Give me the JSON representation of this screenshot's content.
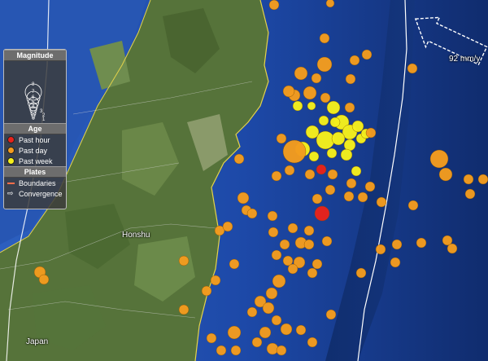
{
  "legend": {
    "magnitude_title": "Magnitude",
    "magnitude_scale": [
      "8",
      "7",
      "6",
      "5",
      "4",
      "3",
      "2",
      "1"
    ],
    "age_title": "Age",
    "age_items": [
      {
        "label": "Past hour",
        "color": "#e8231b"
      },
      {
        "label": "Past day",
        "color": "#f39c1f"
      },
      {
        "label": "Past week",
        "color": "#f5f01c"
      }
    ],
    "plates_title": "Plates",
    "plates_items": [
      {
        "label": "Boundaries",
        "icon": "red-line-icon"
      },
      {
        "label": "Convergence",
        "icon": "arrow-icon"
      }
    ]
  },
  "labels": {
    "region": "Honshu",
    "country": "Japan",
    "convergence_rate": "92 mm/y"
  },
  "colors": {
    "ocean": "#1b3f8f",
    "land": "#5b7a3a",
    "past_hour": "#e8231b",
    "past_day": "#f39c1f",
    "past_week": "#f5f01c"
  }
}
